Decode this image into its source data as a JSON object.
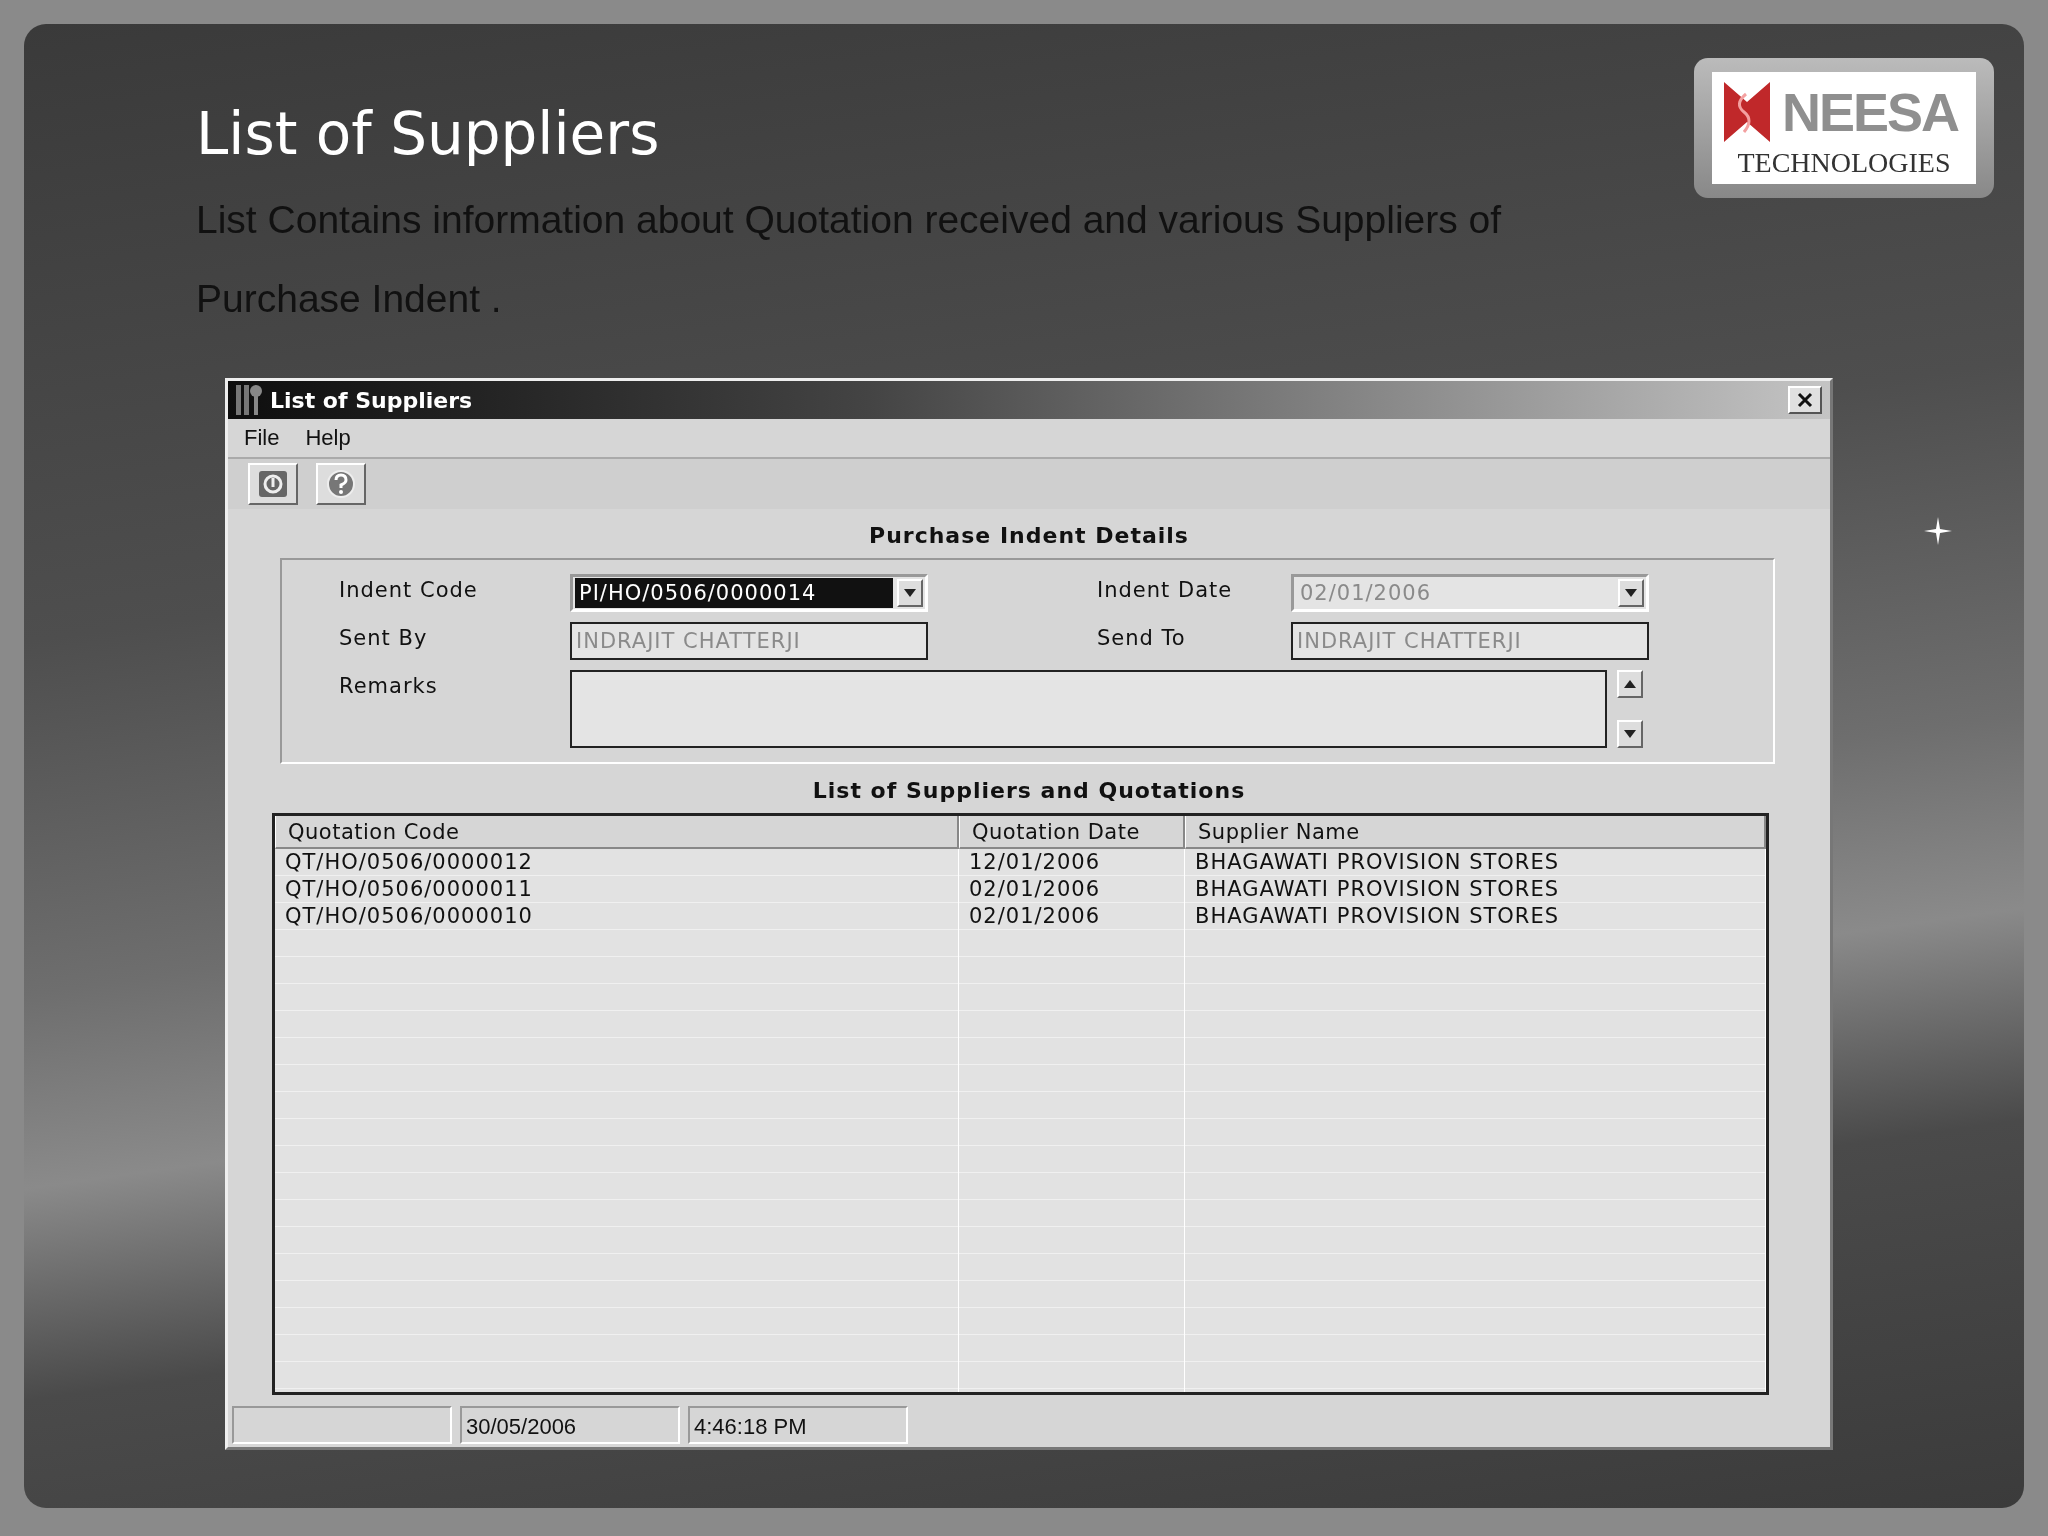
{
  "slide": {
    "title": "List of Suppliers",
    "description": "List Contains information about Quotation received and various Suppliers of Purchase Indent ."
  },
  "logo": {
    "name": "NEESA",
    "tagline": "TECHNOLOGIES"
  },
  "window": {
    "title": "List of Suppliers"
  },
  "menu": [
    "File",
    "Help"
  ],
  "toolbar": [
    {
      "kind": "exit"
    },
    {
      "kind": "help"
    }
  ],
  "indent_section": {
    "heading": "Purchase Indent Details",
    "indent_code": {
      "label": "Indent Code",
      "value": "PI/HO/0506/0000014",
      "disabled": false,
      "highlighted": true
    },
    "indent_date": {
      "label": "Indent Date",
      "value": "02/01/2006",
      "disabled": true
    },
    "sent_by": {
      "label": "Sent By",
      "value": "INDRAJIT  CHATTERJI",
      "disabled": true
    },
    "send_to": {
      "label": "Send To",
      "value": "INDRAJIT  CHATTERJI",
      "disabled": true
    },
    "remarks": {
      "label": "Remarks"
    }
  },
  "table": {
    "heading": "List of Suppliers and Quotations",
    "columns": [
      "Quotation Code",
      "Quotation Date",
      "Supplier Name"
    ],
    "rows": [
      [
        "QT/HO/0506/0000012",
        "12/01/2006",
        "BHAGAWATI PROVISION STORES"
      ],
      [
        "QT/HO/0506/0000011",
        "02/01/2006",
        "BHAGAWATI PROVISION STORES"
      ],
      [
        "QT/HO/0506/0000010",
        "02/01/2006",
        "BHAGAWATI PROVISION STORES"
      ]
    ]
  },
  "status_bar": [
    "30/05/2006",
    "4:46:18 PM"
  ]
}
